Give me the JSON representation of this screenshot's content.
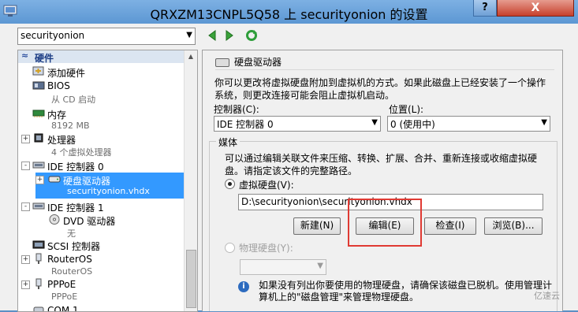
{
  "window": {
    "title": "QRXZM13CNPL5Q58 上 securityonion 的设置",
    "help_label": "?",
    "close_label": "X"
  },
  "toolbar": {
    "vm_selected": "securityonion"
  },
  "tree": {
    "header": "硬件",
    "items": [
      {
        "label": "添加硬件"
      },
      {
        "label": "BIOS",
        "sub": "从 CD 启动"
      },
      {
        "label": "内存",
        "sub": "8192 MB"
      },
      {
        "label": "处理器",
        "sub": "4 个虚拟处理器"
      },
      {
        "label": "IDE 控制器 0"
      },
      {
        "label": "硬盘驱动器",
        "sub": "securityonion.vhdx"
      },
      {
        "label": "IDE 控制器 1"
      },
      {
        "label": "DVD 驱动器",
        "sub": "无"
      },
      {
        "label": "SCSI 控制器"
      },
      {
        "label": "RouterOS",
        "sub": "RouterOS"
      },
      {
        "label": "PPPoE",
        "sub": "PPPoE"
      },
      {
        "label": "COM 1"
      }
    ]
  },
  "panel": {
    "title": "硬盘驱动器",
    "description": "你可以更改将虚拟硬盘附加到虚拟机的方式。如果此磁盘上已经安装了一个操作系统，则更改连接可能会阻止虚拟机启动。",
    "controller_label": "控制器(C):",
    "controller_value": "IDE 控制器 0",
    "location_label": "位置(L):",
    "location_value": "0 (使用中)",
    "media_title": "媒体",
    "media_desc": "可以通过编辑关联文件来压缩、转换、扩展、合并、重新连接或收缩虚拟硬盘。请指定该文件的完整路径。",
    "vhd_label": "虚拟硬盘(V):",
    "vhd_path": "D:\\securityonion\\securityonion.vhdx",
    "btn_new": "新建(N)",
    "btn_edit": "编辑(E)",
    "btn_inspect": "检查(I)",
    "btn_browse": "浏览(B)...",
    "physical_label": "物理硬盘(Y):",
    "info_text": "如果没有列出你要使用的物理硬盘，请确保该磁盘已脱机。使用管理计算机上的\"磁盘管理\"来管理物理硬盘。"
  },
  "watermark": "亿速云"
}
